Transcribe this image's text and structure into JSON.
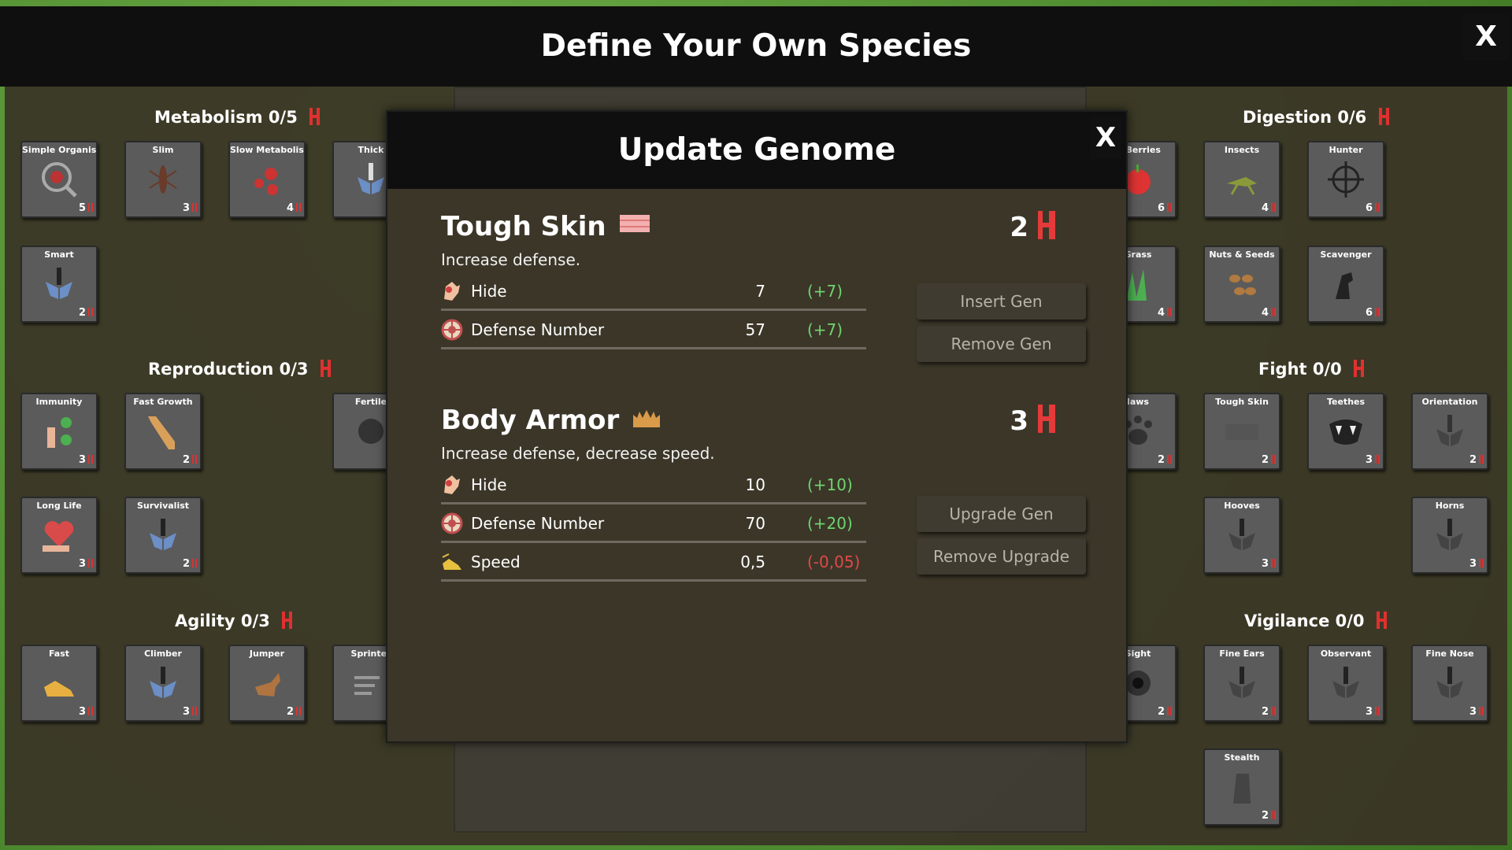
{
  "main_title": "Define Your Own Species",
  "close_label": "X",
  "groups": {
    "metabolism": {
      "label": "Metabolism",
      "count": "0/5"
    },
    "reproduction": {
      "label": "Reproduction",
      "count": "0/3"
    },
    "agility": {
      "label": "Agility",
      "count": "0/3"
    },
    "digestion": {
      "label": "Digestion",
      "count": "0/6"
    },
    "fight": {
      "label": "Fight",
      "count": "0/0"
    },
    "vigilance": {
      "label": "Vigilance",
      "count": "0/0"
    }
  },
  "cards": {
    "simple_organism": {
      "name": "Simple Organism",
      "cost": "5",
      "icon": "microscope-icon"
    },
    "slim": {
      "name": "Slim",
      "cost": "3",
      "icon": "ant-icon"
    },
    "slow_metabolism": {
      "name": "Slow Metabolism",
      "cost": "4",
      "icon": "virus-icon"
    },
    "thick": {
      "name": "Thick",
      "cost": "",
      "icon": "dna-hands-icon"
    },
    "smart": {
      "name": "Smart",
      "cost": "2",
      "icon": "dna-hands-icon"
    },
    "immunity": {
      "name": "Immunity",
      "cost": "3",
      "icon": "immunity-icon"
    },
    "fast_growth": {
      "name": "Fast Growth",
      "cost": "2",
      "icon": "giraffe-icon"
    },
    "fertile": {
      "name": "Fertile",
      "cost": "",
      "icon": "fertile-icon"
    },
    "long_life": {
      "name": "Long Life",
      "cost": "3",
      "icon": "heart-hand-icon"
    },
    "survivalist": {
      "name": "Survivalist",
      "cost": "2",
      "icon": "dna-hands-icon"
    },
    "fast": {
      "name": "Fast",
      "cost": "3",
      "icon": "shoe-icon"
    },
    "climber": {
      "name": "Climber",
      "cost": "3",
      "icon": "dna-hands-icon"
    },
    "jumper": {
      "name": "Jumper",
      "cost": "2",
      "icon": "deer-icon"
    },
    "sprinter": {
      "name": "Sprinter",
      "cost": "",
      "icon": "wind-icon"
    },
    "fruits_berries": {
      "name": "& Berries",
      "cost": "6",
      "icon": "apple-icon"
    },
    "insects": {
      "name": "Insects",
      "cost": "4",
      "icon": "grasshopper-icon"
    },
    "hunter": {
      "name": "Hunter",
      "cost": "6",
      "icon": "crosshair-icon"
    },
    "grass": {
      "name": "Grass",
      "cost": "4",
      "icon": "grass-icon"
    },
    "nuts_seeds": {
      "name": "Nuts & Seeds",
      "cost": "4",
      "icon": "nuts-icon"
    },
    "scavenger": {
      "name": "Scavenger",
      "cost": "6",
      "icon": "vulture-icon"
    },
    "claws": {
      "name": "laws",
      "cost": "2",
      "icon": "paw-icon"
    },
    "tough_skin": {
      "name": "Tough Skin",
      "cost": "2",
      "icon": "skin-icon"
    },
    "teethes": {
      "name": "Teethes",
      "cost": "3",
      "icon": "fangs-icon"
    },
    "orientation": {
      "name": "Orientation",
      "cost": "2",
      "icon": "dna-hands-icon"
    },
    "hooves": {
      "name": "Hooves",
      "cost": "3",
      "icon": "dna-hands-icon"
    },
    "horns": {
      "name": "Horns",
      "cost": "3",
      "icon": "dna-hands-icon"
    },
    "sight": {
      "name": "Sight",
      "cost": "2",
      "icon": "eye-icon"
    },
    "fine_ears": {
      "name": "Fine Ears",
      "cost": "2",
      "icon": "dna-hands-icon"
    },
    "observant": {
      "name": "Observant",
      "cost": "3",
      "icon": "dna-hands-icon"
    },
    "fine_nose": {
      "name": "Fine Nose",
      "cost": "3",
      "icon": "dna-hands-icon"
    },
    "stealth": {
      "name": "Stealth",
      "cost": "2",
      "icon": "stealth-icon"
    }
  },
  "modal": {
    "title": "Update Genome",
    "close_label": "X",
    "genes": [
      {
        "name": "Tough Skin",
        "cost": "2",
        "icon": "skin-icon",
        "description": "Increase defense.",
        "stats": [
          {
            "name": "Hide",
            "value": "7",
            "delta": "(+7)",
            "icon": "hide-icon"
          },
          {
            "name": "Defense Number",
            "value": "57",
            "delta": "(+7)",
            "icon": "shield-icon"
          }
        ]
      },
      {
        "name": "Body Armor",
        "cost": "3",
        "icon": "armor-icon",
        "description": "Increase defense, decrease speed.",
        "stats": [
          {
            "name": "Hide",
            "value": "10",
            "delta": "(+10)",
            "icon": "hide-icon"
          },
          {
            "name": "Defense Number",
            "value": "70",
            "delta": "(+20)",
            "icon": "shield-icon"
          },
          {
            "name": "Speed",
            "value": "0,5",
            "delta": "(-0,05)",
            "icon": "shoe-icon"
          }
        ]
      }
    ],
    "buttons": {
      "insert": "Insert Gen",
      "remove": "Remove Gen",
      "upgrade": "Upgrade Gen",
      "remove_upgrade": "Remove Upgrade"
    }
  },
  "colors": {
    "positive": "#6fd46f",
    "negative": "#e04a4a",
    "dna": "#e03030"
  }
}
